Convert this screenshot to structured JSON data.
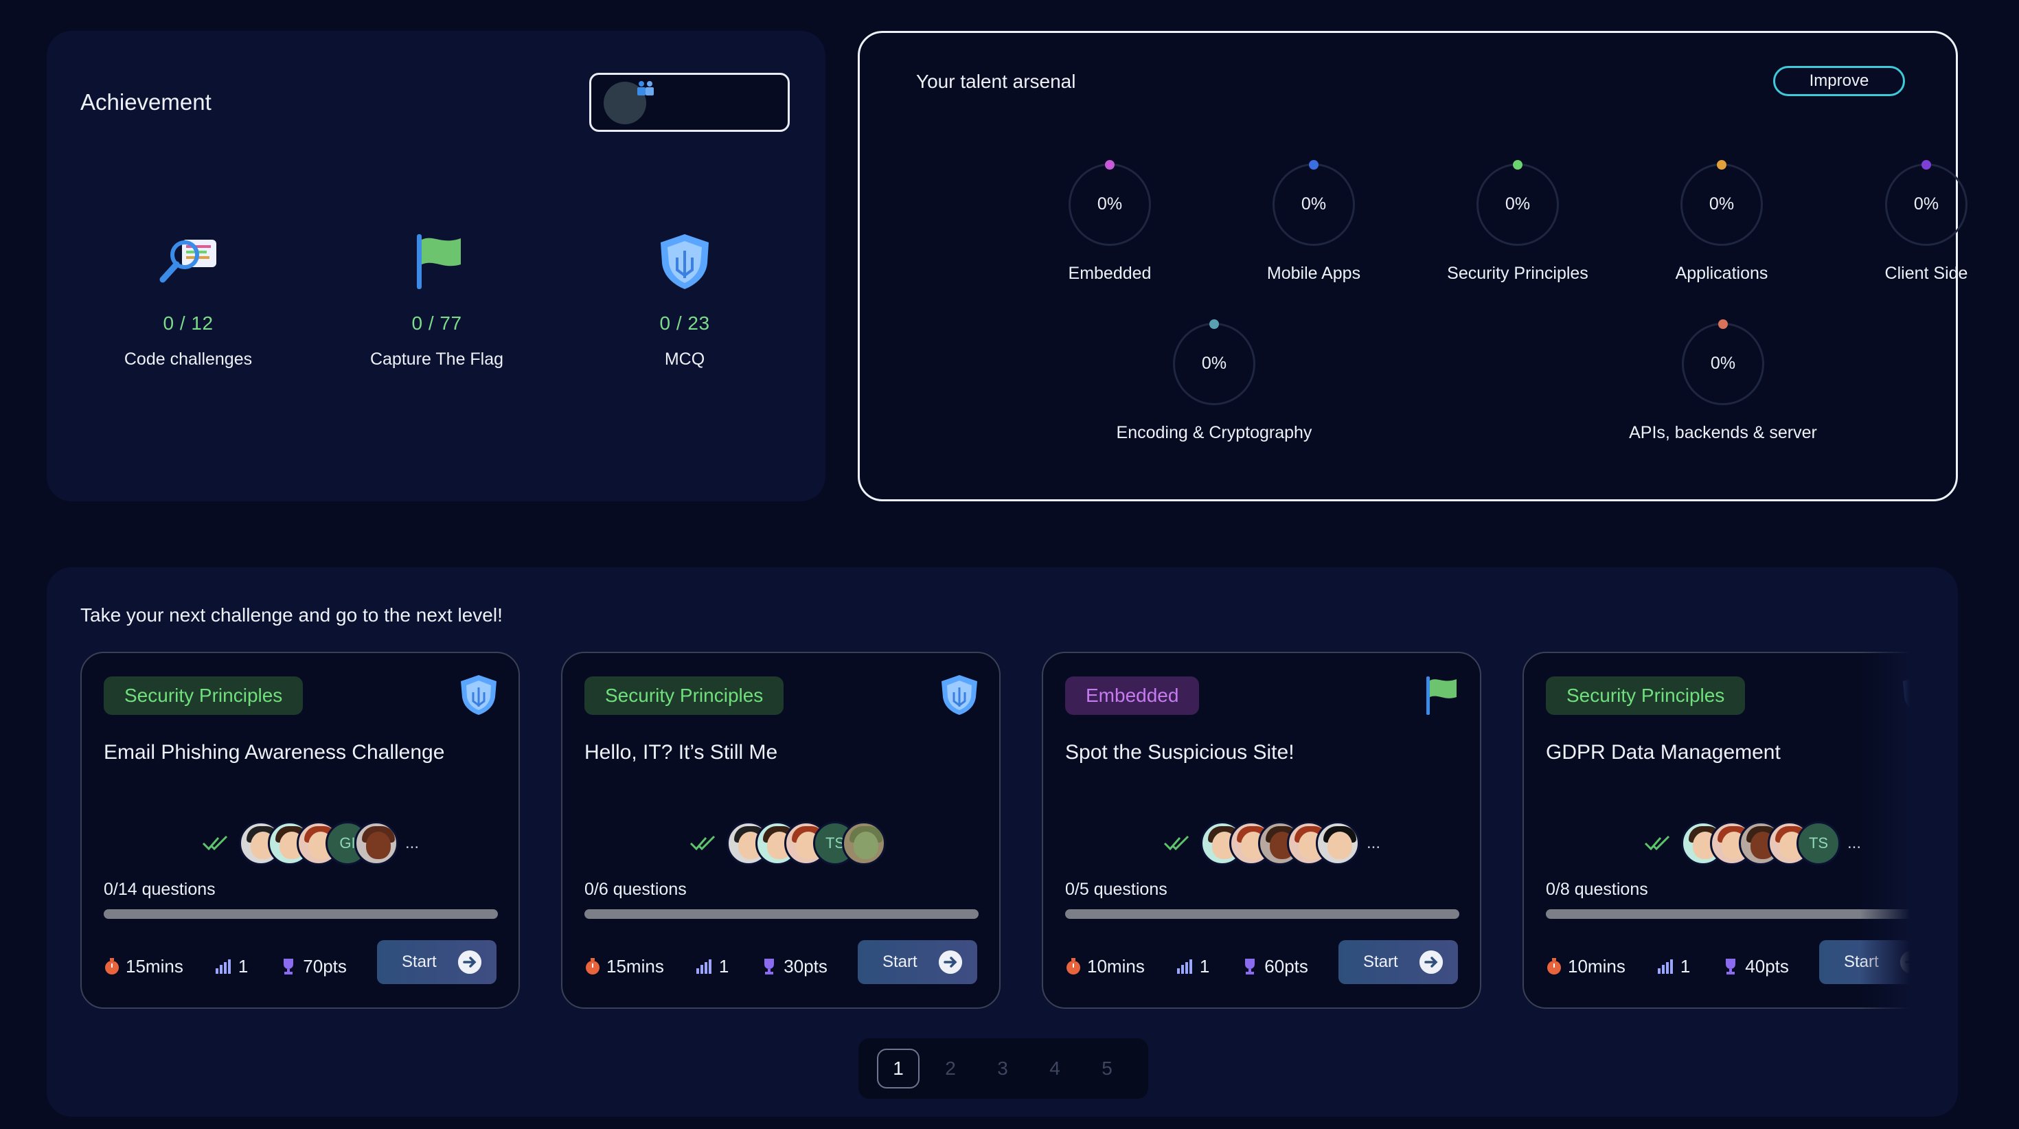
{
  "achievement": {
    "title": "Achievement",
    "items": [
      {
        "count": "0 / 12",
        "label": "Code challenges",
        "icon": "magnifier-icon"
      },
      {
        "count": "0 / 77",
        "label": "Capture The Flag",
        "icon": "flag-icon"
      },
      {
        "count": "0 / 23",
        "label": "MCQ",
        "icon": "shield-icon"
      }
    ]
  },
  "talent": {
    "title": "Your talent arsenal",
    "improve_label": "Improve",
    "skills": [
      {
        "pct": "0%",
        "name": "Embedded",
        "color": "#c75ad9"
      },
      {
        "pct": "0%",
        "name": "Mobile Apps",
        "color": "#3b6fe0"
      },
      {
        "pct": "0%",
        "name": "Security Principles",
        "color": "#6ad46e"
      },
      {
        "pct": "0%",
        "name": "Applications",
        "color": "#e0a03b"
      },
      {
        "pct": "0%",
        "name": "Client Side",
        "color": "#7d3fd6"
      },
      {
        "pct": "0%",
        "name": "Encoding & Cryptography",
        "color": "#5aa0b0"
      },
      {
        "pct": "0%",
        "name": "APIs, backends & server",
        "color": "#d9725a"
      }
    ]
  },
  "challenges": {
    "heading": "Take your next challenge and go to the next level!",
    "cards": [
      {
        "tag": "Security Principles",
        "title": "Email Phishing Awareness Challenge",
        "questions": "0/14 questions",
        "time": "15mins",
        "level": "1",
        "points": "70pts",
        "start": "Start",
        "avatar_initials": "GI",
        "more": "..."
      },
      {
        "tag": "Security Principles",
        "title": "Hello, IT? It’s Still Me",
        "questions": "0/6 questions",
        "time": "15mins",
        "level": "1",
        "points": "30pts",
        "start": "Start",
        "avatar_initials": "TS",
        "more": ""
      },
      {
        "tag": "Embedded",
        "title": "Spot the Suspicious Site!",
        "questions": "0/5 questions",
        "time": "10mins",
        "level": "1",
        "points": "60pts",
        "start": "Start",
        "more": "..."
      },
      {
        "tag": "Security Principles",
        "title": "GDPR Data Management",
        "questions": "0/8 questions",
        "time": "10mins",
        "level": "1",
        "points": "40pts",
        "start": "Start",
        "avatar_initials": "TS",
        "more": "..."
      }
    ]
  },
  "pagination": {
    "pages": [
      "1",
      "2",
      "3",
      "4",
      "5"
    ],
    "current": "1"
  }
}
